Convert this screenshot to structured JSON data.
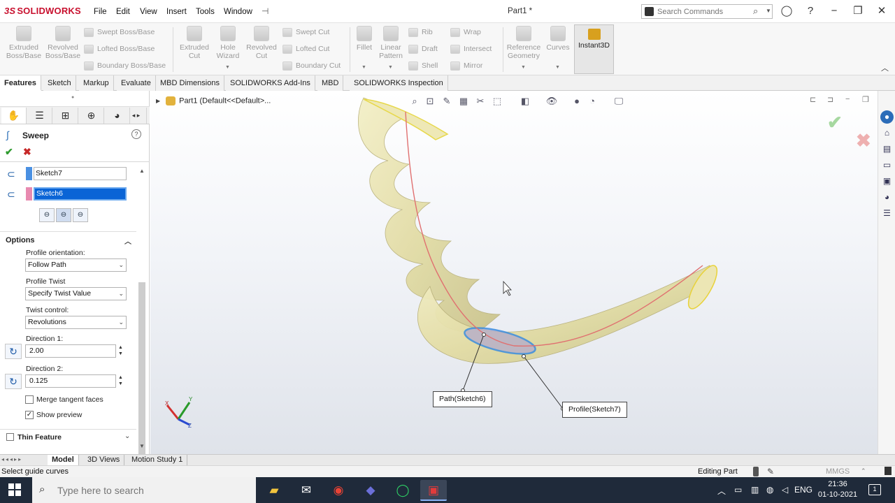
{
  "app": {
    "logo_ds": "3S",
    "logo_text": "SOLIDWORKS",
    "document_title": "Part1 *",
    "menu": [
      "File",
      "Edit",
      "View",
      "Insert",
      "Tools",
      "Window"
    ],
    "search_placeholder": "Search Commands"
  },
  "ribbon": {
    "extruded_boss": "Extruded Boss/Base",
    "revolved_boss": "Revolved Boss/Base",
    "swept_boss": "Swept Boss/Base",
    "lofted_boss": "Lofted Boss/Base",
    "boundary_boss": "Boundary Boss/Base",
    "extruded_cut": "Extruded Cut",
    "hole_wizard": "Hole Wizard",
    "revolved_cut": "Revolved Cut",
    "swept_cut": "Swept Cut",
    "lofted_cut": "Lofted Cut",
    "boundary_cut": "Boundary Cut",
    "fillet": "Fillet",
    "linear_pattern": "Linear Pattern",
    "rib": "Rib",
    "draft": "Draft",
    "shell": "Shell",
    "wrap": "Wrap",
    "intersect": "Intersect",
    "mirror": "Mirror",
    "reference_geometry": "Reference Geometry",
    "curves": "Curves",
    "instant3d": "Instant3D"
  },
  "tabs": [
    "Features",
    "Sketch",
    "Markup",
    "Evaluate",
    "MBD Dimensions",
    "SOLIDWORKS Add-Ins",
    "MBD",
    "SOLIDWORKS Inspection"
  ],
  "property_manager": {
    "title": "Sweep",
    "profile_value": "Sketch7",
    "path_value": "Sketch6",
    "options_header": "Options",
    "profile_orientation_label": "Profile orientation:",
    "profile_orientation_value": "Follow Path",
    "profile_twist_label": "Profile Twist",
    "profile_twist_value": "Specify Twist Value",
    "twist_control_label": "Twist control:",
    "twist_control_value": "Revolutions",
    "direction1_label": "Direction 1:",
    "direction1_value": "2.00",
    "direction2_label": "Direction 2:",
    "direction2_value": "0.125",
    "merge_tangent_label": "Merge tangent faces",
    "merge_tangent_checked": false,
    "show_preview_label": "Show preview",
    "show_preview_checked": true,
    "thin_feature_label": "Thin Feature"
  },
  "viewport": {
    "tree_item": "Part1  (Default<<Default>...",
    "path_callout": "Path(Sketch6)",
    "profile_callout": "Profile(Sketch7)",
    "triad_x": "X",
    "triad_y": "Y",
    "triad_z": "Z"
  },
  "bottom_tabs": [
    "Model",
    "3D Views",
    "Motion Study 1"
  ],
  "status": {
    "message": "Select guide curves",
    "editing": "Editing Part",
    "units": "MMGS"
  },
  "taskbar": {
    "search_placeholder": "Type here to search",
    "language": "ENG",
    "time": "21:36",
    "date": "01-10-2021",
    "notification_count": "1"
  },
  "colors": {
    "accent_red": "#c8102e",
    "selection_blue": "#0a64d6",
    "model_fill": "#e8e3b0",
    "path_line": "#e07070"
  }
}
